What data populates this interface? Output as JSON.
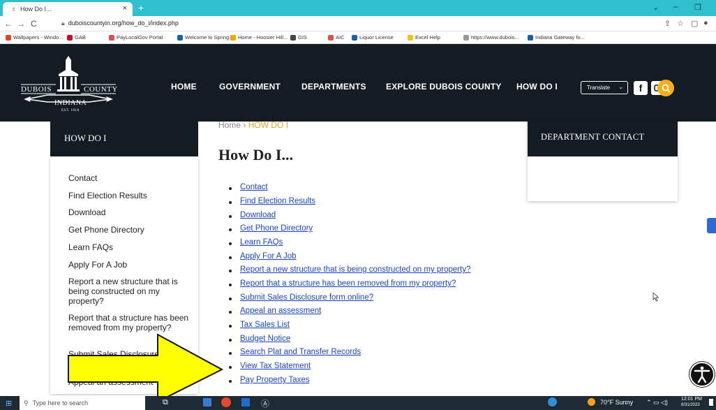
{
  "browser": {
    "tab_title": "How Do I...",
    "tab_close": "×",
    "new_tab": "+",
    "url": "duboiscountyin.org/how_do_i/index.php",
    "bookmarks": [
      {
        "label": "Wallpapers - Windo...",
        "color": "#e0452b"
      },
      {
        "label": "GAB",
        "color": "#c8102e"
      },
      {
        "label": "PayLocalGov Portal",
        "color": "#d9534f"
      },
      {
        "label": "Welcome to Spring...",
        "color": "#1f5fa8"
      },
      {
        "label": "Home - Hoosier Hill...",
        "color": "#f0a500"
      },
      {
        "label": "GIS",
        "color": "#444444"
      },
      {
        "label": "AIC",
        "color": "#d9534f"
      },
      {
        "label": "Liquor License",
        "color": "#1f5fa8"
      },
      {
        "label": "Excel Help",
        "color": "#f4c20d"
      },
      {
        "label": "https://www.dubois...",
        "color": "#999999"
      },
      {
        "label": "Indiana Gateway fo...",
        "color": "#1f5fa8"
      }
    ]
  },
  "header": {
    "logo": {
      "left": "DUBOIS",
      "right": "COUNTY",
      "state": "INDIANA",
      "est": "EST. 1818"
    },
    "nav": [
      "HOME",
      "GOVERNMENT",
      "DEPARTMENTS",
      "EXPLORE DUBOIS COUNTY",
      "HOW DO I"
    ],
    "translate_label": "Translate",
    "accent_color": "#f2b01e"
  },
  "sidebar": {
    "title": "HOW DO I",
    "items": [
      "Contact",
      "Find Election Results",
      "Download",
      "Get Phone Directory",
      "Learn FAQs",
      "Apply For A Job",
      "Report a new structure that is being constructed on my property?",
      "Report that a structure has been removed from my property?",
      "Submit Sales Disclosure form online?",
      "Appeal an assessment"
    ]
  },
  "main": {
    "breadcrumb_home": "Home",
    "breadcrumb_sep": "›",
    "breadcrumb_current": "HOW DO I",
    "title": "How Do I...",
    "links": [
      "Contact",
      "Find Election Results",
      "Download",
      "Get Phone Directory",
      "Learn FAQs",
      "Apply For A Job",
      "Report a new structure that is being constructed on my property?",
      "Report that a structure has been removed from my property?",
      "Submit Sales Disclosure form online?",
      "Appeal an assessment",
      "Tax Sales List",
      "Budget Notice",
      "Search Plat and Transfer Records",
      "View Tax Statement",
      "Pay Property Taxes"
    ]
  },
  "contact_box": {
    "title": "DEPARTMENT CONTACT"
  },
  "taskbar": {
    "search_placeholder": "Type here to search",
    "weather": "70°F Sunny",
    "time": "12:01 PM",
    "date": "8/31/2023"
  }
}
